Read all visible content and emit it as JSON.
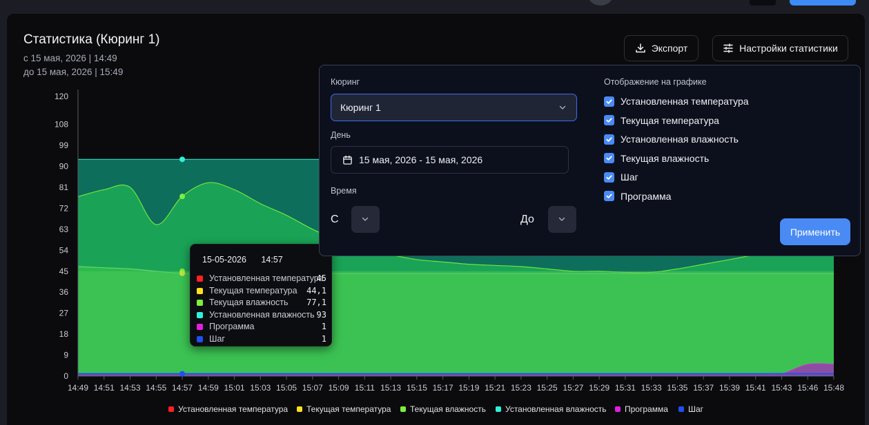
{
  "page": {
    "title": "Статистика (Кюринг 1)",
    "range_from": "с 15 мая, 2026 | 14:49",
    "range_to": "до 15 мая, 2026 | 15:49"
  },
  "toolbar": {
    "export_label": "Экспорт",
    "settings_label": "Настройки статистики"
  },
  "settings_panel": {
    "curing_label": "Кюринг",
    "curing_value": "Кюринг 1",
    "day_label": "День",
    "day_value": "15 мая, 2026 - 15 мая, 2026",
    "time_label": "Время",
    "from_label": "С",
    "to_label": "До",
    "display_label": "Отображение на графике",
    "checkboxes": [
      {
        "label": "Установленная температура",
        "checked": true
      },
      {
        "label": "Текущая температура",
        "checked": true
      },
      {
        "label": "Установленная влажность",
        "checked": true
      },
      {
        "label": "Текущая влажность",
        "checked": true
      },
      {
        "label": "Шаг",
        "checked": true
      },
      {
        "label": "Программа",
        "checked": true
      }
    ],
    "apply_label": "Применить"
  },
  "tooltip": {
    "date": "15-05-2026",
    "time": "14:57",
    "rows": [
      {
        "label": "Установленная температура",
        "value": "45",
        "color": "#ff2020"
      },
      {
        "label": "Текущая температура",
        "value": "44,1",
        "color": "#ffe020"
      },
      {
        "label": "Текущая влажность",
        "value": "77,1",
        "color": "#7cf03a"
      },
      {
        "label": "Установленная влажность",
        "value": "93",
        "color": "#2ff0d8"
      },
      {
        "label": "Программа",
        "value": "1",
        "color": "#e020e0"
      },
      {
        "label": "Шаг",
        "value": "1",
        "color": "#2050f0"
      }
    ]
  },
  "chart_data": {
    "type": "area",
    "x": [
      "14:49",
      "14:51",
      "14:53",
      "14:55",
      "14:57",
      "14:59",
      "15:01",
      "15:03",
      "15:05",
      "15:07",
      "15:09",
      "15:11",
      "15:13",
      "15:15",
      "15:17",
      "15:19",
      "15:21",
      "15:23",
      "15:25",
      "15:27",
      "15:29",
      "15:31",
      "15:33",
      "15:35",
      "15:37",
      "15:39",
      "15:41",
      "15:43",
      "15:46",
      "15:48"
    ],
    "ylim": [
      0,
      120
    ],
    "yticks": [
      0,
      9,
      18,
      27,
      36,
      45,
      54,
      63,
      72,
      81,
      90,
      99,
      108,
      120
    ],
    "series": [
      {
        "name": "Установленная температура",
        "color": "#ff2020",
        "values": [
          45,
          45,
          45,
          45,
          45,
          45,
          45,
          45,
          45,
          45,
          45,
          45,
          45,
          45,
          45,
          45,
          45,
          45,
          45,
          45,
          45,
          45,
          45,
          45,
          45,
          45,
          45,
          45,
          45,
          45
        ]
      },
      {
        "name": "Текущая температура",
        "color": "#ffe020",
        "values": [
          47,
          46.5,
          46,
          45,
          44.1,
          44,
          44,
          44,
          44,
          44,
          44,
          44,
          44,
          44,
          44,
          44,
          44,
          44,
          44,
          44,
          44,
          44,
          44,
          44,
          44,
          44,
          44,
          44,
          44,
          44
        ]
      },
      {
        "name": "Текущая влажность",
        "color": "#7cf03a",
        "values": [
          77,
          80,
          81,
          65,
          77.1,
          83,
          80,
          74,
          69,
          63,
          58,
          54,
          52,
          50,
          49,
          48,
          47.5,
          47,
          46,
          45,
          45,
          44.5,
          44.5,
          46,
          48,
          50,
          52,
          53,
          53,
          53
        ]
      },
      {
        "name": "Установленная влажность",
        "color": "#2ff0d8",
        "values": [
          93,
          93,
          93,
          93,
          93,
          93,
          93,
          93,
          93,
          93,
          93,
          93,
          93,
          93,
          93,
          93,
          93,
          93,
          93,
          93,
          93,
          93,
          93,
          93,
          93,
          93,
          93,
          93,
          93,
          93
        ]
      },
      {
        "name": "Программа",
        "color": "#e020e0",
        "values": [
          1,
          1,
          1,
          1,
          1,
          1,
          1,
          1,
          1,
          1,
          1,
          1,
          1,
          1,
          1,
          1,
          1,
          1,
          1,
          1,
          1,
          1,
          1,
          1,
          1,
          1,
          1,
          1,
          5,
          5
        ]
      },
      {
        "name": "Шаг",
        "color": "#2050f0",
        "values": [
          1,
          1,
          1,
          1,
          1,
          1,
          1,
          1,
          1,
          1,
          1,
          1,
          1,
          1,
          1,
          1,
          1,
          1,
          1,
          1,
          1,
          1,
          1,
          1,
          1,
          1,
          1,
          1,
          1,
          1
        ]
      }
    ],
    "highlight_index": 4,
    "legend_position": "bottom"
  },
  "legend": [
    {
      "label": "Установленная температура",
      "color": "#ff2020"
    },
    {
      "label": "Текущая температура",
      "color": "#ffe020"
    },
    {
      "label": "Текущая влажность",
      "color": "#7cf03a"
    },
    {
      "label": "Установленная влажность",
      "color": "#2ff0d8"
    },
    {
      "label": "Программа",
      "color": "#e020e0"
    },
    {
      "label": "Шаг",
      "color": "#2050f0"
    }
  ]
}
